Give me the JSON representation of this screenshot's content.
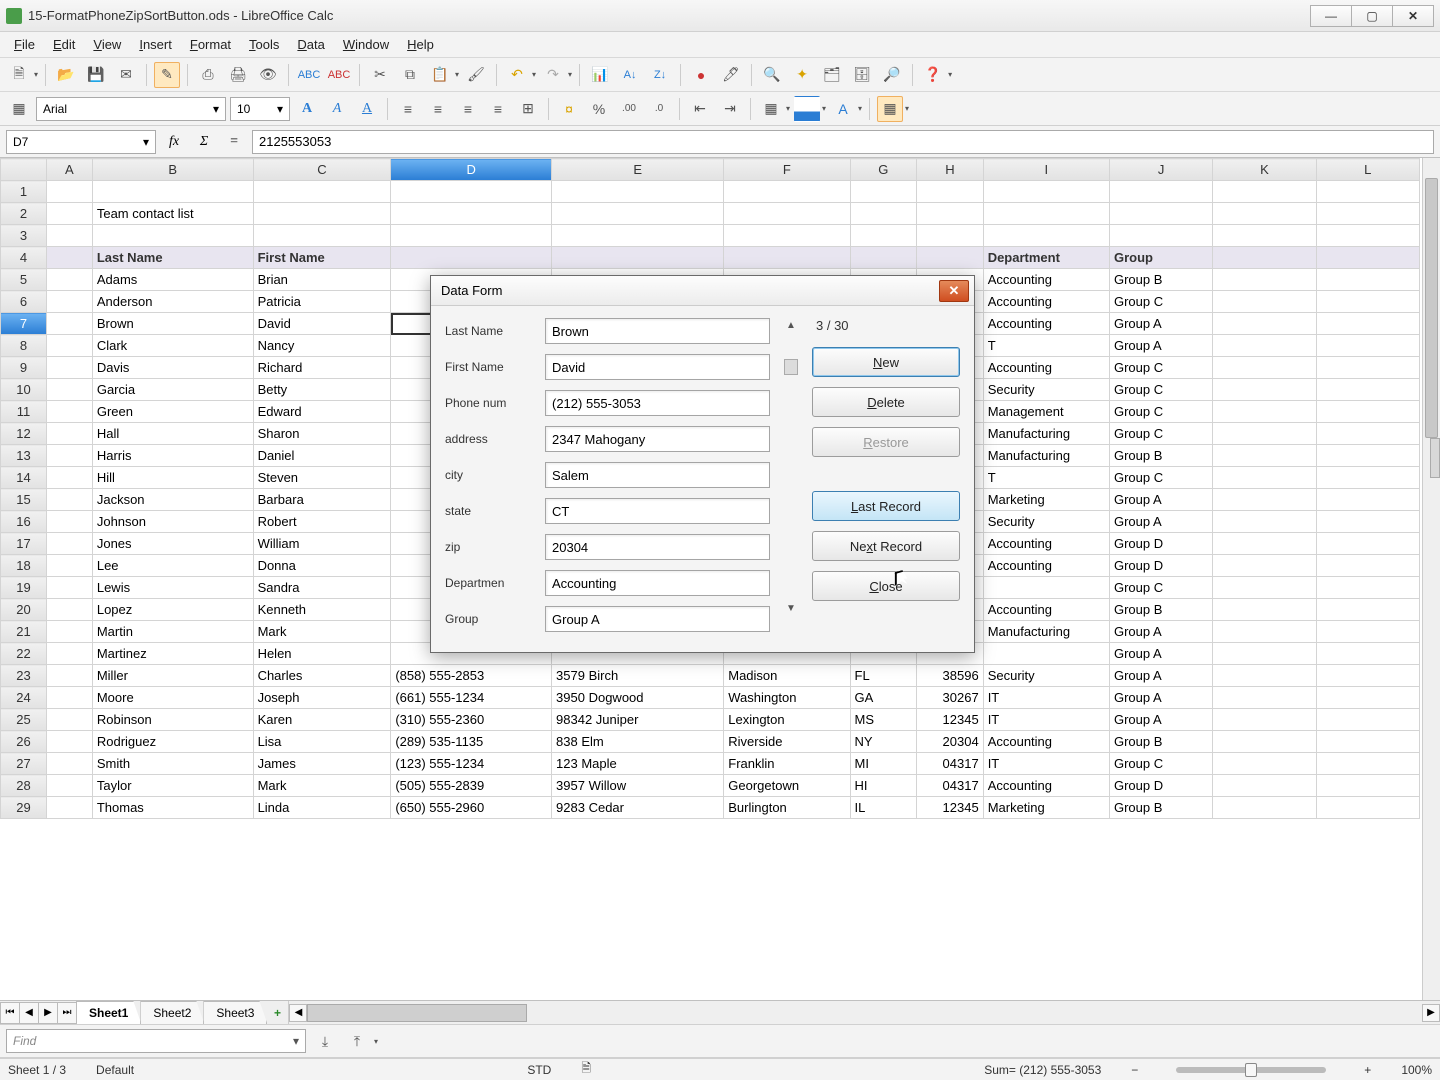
{
  "title": "15-FormatPhoneZipSortButton.ods - LibreOffice Calc",
  "menu": [
    "File",
    "Edit",
    "View",
    "Insert",
    "Format",
    "Tools",
    "Data",
    "Window",
    "Help"
  ],
  "font": {
    "name": "Arial",
    "size": "10"
  },
  "cellref": "D7",
  "formula": "2125553053",
  "columns": [
    "A",
    "B",
    "C",
    "D",
    "E",
    "F",
    "G",
    "H",
    "I",
    "J",
    "K",
    "L"
  ],
  "selectedCol": "D",
  "selectedRow": 7,
  "sheet": {
    "title_cell": "Team contact list",
    "headers": [
      "Last Name",
      "First Name",
      "",
      "",
      "",
      "",
      "",
      "Department",
      "Group"
    ],
    "rows": [
      {
        "r": 5,
        "ln": "Adams",
        "fn": "Brian",
        "dept": "Accounting",
        "grp": "Group B"
      },
      {
        "r": 6,
        "ln": "Anderson",
        "fn": "Patricia",
        "dept": "Accounting",
        "grp": "Group C"
      },
      {
        "r": 7,
        "ln": "Brown",
        "fn": "David",
        "dept": "Accounting",
        "grp": "Group A"
      },
      {
        "r": 8,
        "ln": "Clark",
        "fn": "Nancy",
        "dept": "T",
        "grp": "Group A"
      },
      {
        "r": 9,
        "ln": "Davis",
        "fn": "Richard",
        "dept": "Accounting",
        "grp": "Group C"
      },
      {
        "r": 10,
        "ln": "Garcia",
        "fn": "Betty",
        "dept": "Security",
        "grp": "Group C"
      },
      {
        "r": 11,
        "ln": "Green",
        "fn": "Edward",
        "dept": "Management",
        "grp": "Group C"
      },
      {
        "r": 12,
        "ln": "Hall",
        "fn": "Sharon",
        "dept": "Manufacturing",
        "grp": "Group C"
      },
      {
        "r": 13,
        "ln": "Harris",
        "fn": "Daniel",
        "dept": "Manufacturing",
        "grp": "Group B"
      },
      {
        "r": 14,
        "ln": "Hill",
        "fn": "Steven",
        "dept": "T",
        "grp": "Group C"
      },
      {
        "r": 15,
        "ln": "Jackson",
        "fn": "Barbara",
        "dept": "Marketing",
        "grp": "Group A"
      },
      {
        "r": 16,
        "ln": "Johnson",
        "fn": "Robert",
        "dept": "Security",
        "grp": "Group A"
      },
      {
        "r": 17,
        "ln": "Jones",
        "fn": "William",
        "dept": "Accounting",
        "grp": "Group D"
      },
      {
        "r": 18,
        "ln": "Lee",
        "fn": "Donna",
        "dept": "Accounting",
        "grp": "Group D"
      },
      {
        "r": 19,
        "ln": "Lewis",
        "fn": "Sandra",
        "dept": "",
        "grp": "Group C"
      },
      {
        "r": 20,
        "ln": "Lopez",
        "fn": "Kenneth",
        "dept": "Accounting",
        "grp": "Group B"
      },
      {
        "r": 21,
        "ln": "Martin",
        "fn": "Mark",
        "dept": "Manufacturing",
        "grp": "Group A"
      },
      {
        "r": 22,
        "ln": "Martinez",
        "fn": "Helen",
        "dept": "",
        "grp": "Group A"
      },
      {
        "r": 23,
        "ln": "Miller",
        "fn": "Charles",
        "ph": "(858) 555-2853",
        "ad": "3579 Birch",
        "ci": "Madison",
        "st": "FL",
        "zp": "38596",
        "dept": "Security",
        "grp": "Group A"
      },
      {
        "r": 24,
        "ln": "Moore",
        "fn": "Joseph",
        "ph": "(661) 555-1234",
        "ad": "3950 Dogwood",
        "ci": "Washington",
        "st": "GA",
        "zp": "30267",
        "dept": "IT",
        "grp": "Group A"
      },
      {
        "r": 25,
        "ln": "Robinson",
        "fn": "Karen",
        "ph": "(310) 555-2360",
        "ad": "98342 Juniper",
        "ci": "Lexington",
        "st": "MS",
        "zp": "12345",
        "dept": "IT",
        "grp": "Group A"
      },
      {
        "r": 26,
        "ln": "Rodriguez",
        "fn": "Lisa",
        "ph": "(289) 535-1135",
        "ad": "838 Elm",
        "ci": "Riverside",
        "st": "NY",
        "zp": "20304",
        "dept": "Accounting",
        "grp": "Group B"
      },
      {
        "r": 27,
        "ln": "Smith",
        "fn": "James",
        "ph": "(123) 555-1234",
        "ad": "123 Maple",
        "ci": "Franklin",
        "st": "MI",
        "zp": "04317",
        "dept": "IT",
        "grp": "Group C"
      },
      {
        "r": 28,
        "ln": "Taylor",
        "fn": "Mark",
        "ph": "(505) 555-2839",
        "ad": "3957 Willow",
        "ci": "Georgetown",
        "st": "HI",
        "zp": "04317",
        "dept": "Accounting",
        "grp": "Group D"
      },
      {
        "r": 29,
        "ln": "Thomas",
        "fn": "Linda",
        "ph": "(650) 555-2960",
        "ad": "9283 Cedar",
        "ci": "Burlington",
        "st": "IL",
        "zp": "12345",
        "dept": "Marketing",
        "grp": "Group B"
      }
    ]
  },
  "tabs": [
    "Sheet1",
    "Sheet2",
    "Sheet3"
  ],
  "activeTab": "Sheet1",
  "find_placeholder": "Find",
  "status": {
    "sheet": "Sheet 1 / 3",
    "style": "Default",
    "mode": "STD",
    "sum": "Sum= (212) 555-3053",
    "zoom": "100%"
  },
  "dialog": {
    "title": "Data Form",
    "counter": "3 / 30",
    "fields": [
      {
        "label": "Last Name",
        "value": "Brown"
      },
      {
        "label": "First Name",
        "value": "David"
      },
      {
        "label": "Phone num",
        "value": "(212) 555-3053"
      },
      {
        "label": "address",
        "value": "2347 Mahogany"
      },
      {
        "label": "city",
        "value": "Salem"
      },
      {
        "label": "state",
        "value": "CT"
      },
      {
        "label": "zip",
        "value": "20304"
      },
      {
        "label": "Departmen",
        "value": "Accounting"
      },
      {
        "label": "Group",
        "value": "Group A"
      }
    ],
    "buttons": {
      "new": "New",
      "delete": "Delete",
      "restore": "Restore",
      "last": "Last Record",
      "next": "Next Record",
      "close": "Close"
    }
  }
}
